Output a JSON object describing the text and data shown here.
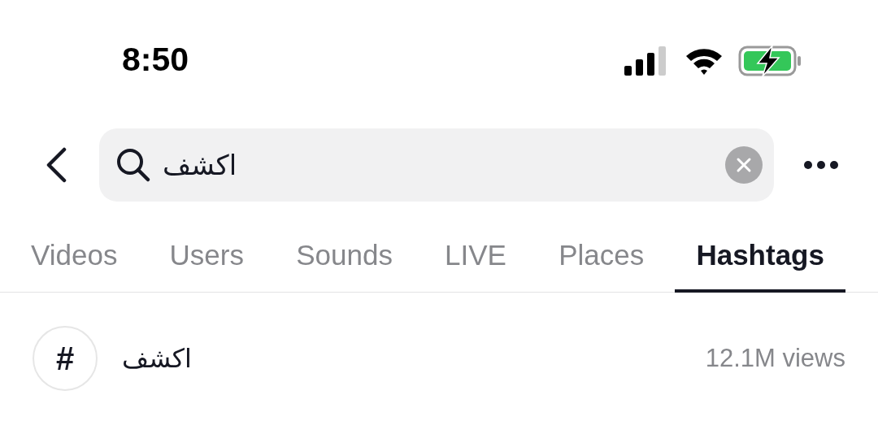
{
  "status_bar": {
    "time": "8:50"
  },
  "search": {
    "value": "اكشف"
  },
  "tabs": [
    {
      "label": "Videos",
      "selected": false
    },
    {
      "label": "Users",
      "selected": false
    },
    {
      "label": "Sounds",
      "selected": false
    },
    {
      "label": "LIVE",
      "selected": false
    },
    {
      "label": "Places",
      "selected": false
    },
    {
      "label": "Hashtags",
      "selected": true
    }
  ],
  "results": [
    {
      "icon": "#",
      "name": "اكشف",
      "views": "12.1M views"
    }
  ]
}
